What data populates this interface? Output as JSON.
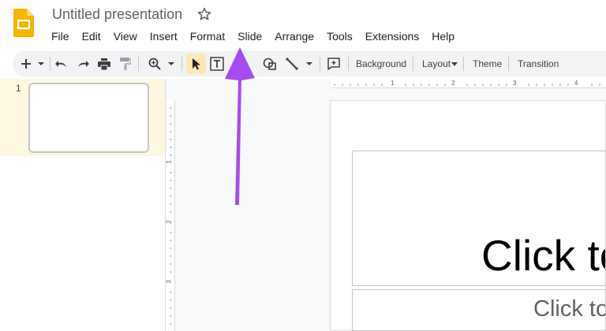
{
  "app": {
    "title": "Untitled presentation",
    "brand_color": "#f4b400"
  },
  "menu": [
    "File",
    "Edit",
    "View",
    "Insert",
    "Format",
    "Slide",
    "Arrange",
    "Tools",
    "Extensions",
    "Help"
  ],
  "toolbar": {
    "background_label": "Background",
    "layout_label": "Layout",
    "theme_label": "Theme",
    "transition_label": "Transition",
    "icons": [
      "add-icon",
      "undo-icon",
      "redo-icon",
      "print-icon",
      "paint-format-icon",
      "zoom-icon",
      "select-cursor-icon",
      "text-box-icon",
      "shape-icon",
      "line-icon",
      "comment-icon"
    ]
  },
  "filmstrip": {
    "slides": [
      {
        "number": "1"
      }
    ]
  },
  "rulers": {
    "horizontal": [
      "1",
      "2",
      "3",
      "4"
    ],
    "vertical": [
      "1",
      "2",
      "3"
    ]
  },
  "slide": {
    "title_placeholder": "Click to",
    "subtitle_placeholder": "Click to"
  },
  "annotation": {
    "color": "#a64bf4",
    "target": "Slide"
  }
}
